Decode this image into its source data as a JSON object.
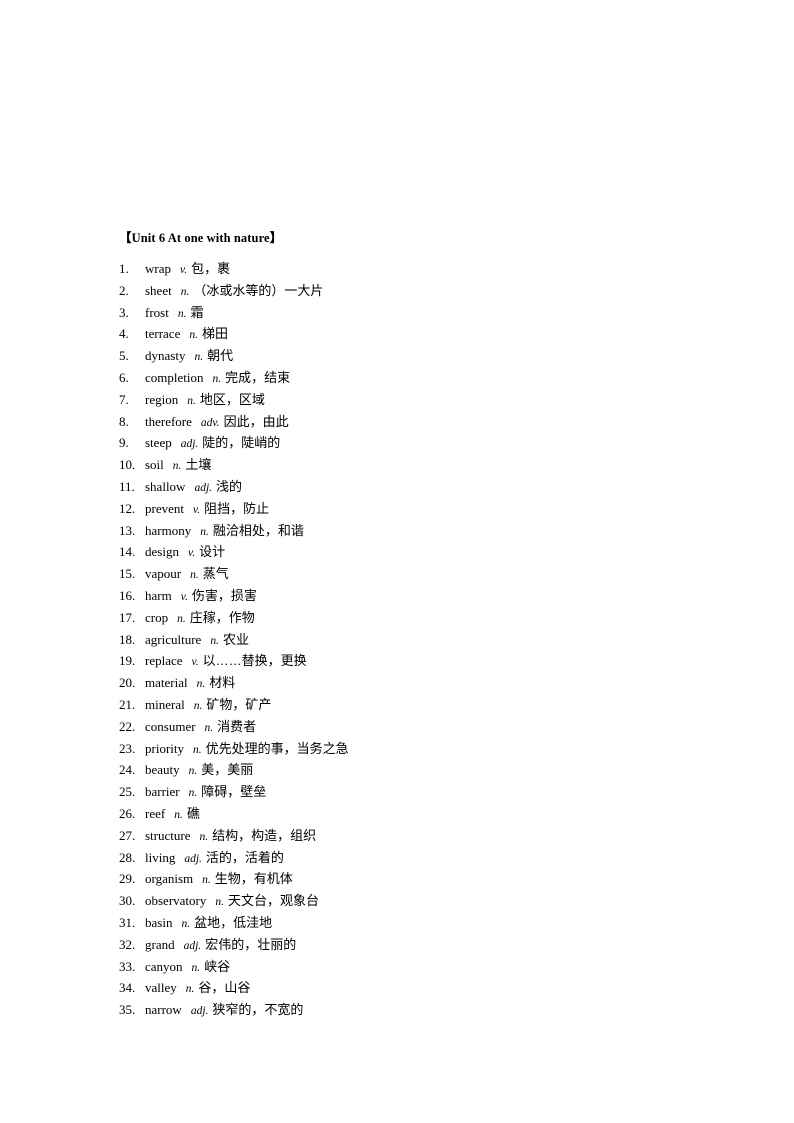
{
  "document": {
    "title": "【Unit 6 At one with nature】",
    "background_color": "#ffffff",
    "text_color": "#000000"
  },
  "vocabulary": [
    {
      "num": "1.",
      "word": "wrap",
      "pos": "v.",
      "definition": "包，裹"
    },
    {
      "num": "2.",
      "word": "sheet",
      "pos": "n.",
      "definition": "（冰或水等的）一大片"
    },
    {
      "num": "3.",
      "word": "frost",
      "pos": "n.",
      "definition": "霜"
    },
    {
      "num": "4.",
      "word": "terrace",
      "pos": "n.",
      "definition": "梯田"
    },
    {
      "num": "5.",
      "word": "dynasty",
      "pos": "n.",
      "definition": "朝代"
    },
    {
      "num": "6.",
      "word": "completion",
      "pos": "n.",
      "definition": "完成，结束"
    },
    {
      "num": "7.",
      "word": "region",
      "pos": "n.",
      "definition": "地区，区域"
    },
    {
      "num": "8.",
      "word": "therefore",
      "pos": "adv.",
      "definition": "因此，由此"
    },
    {
      "num": "9.",
      "word": "steep",
      "pos": "adj.",
      "definition": "陡的，陡峭的"
    },
    {
      "num": "10.",
      "word": "soil",
      "pos": "n.",
      "definition": "土壤"
    },
    {
      "num": "11.",
      "word": "shallow",
      "pos": "adj.",
      "definition": "浅的"
    },
    {
      "num": "12.",
      "word": "prevent",
      "pos": "v.",
      "definition": "阻挡，防止"
    },
    {
      "num": "13.",
      "word": "harmony",
      "pos": "n.",
      "definition": "融洽相处，和谐"
    },
    {
      "num": "14.",
      "word": "design",
      "pos": "v.",
      "definition": "设计"
    },
    {
      "num": "15.",
      "word": "vapour",
      "pos": "n.",
      "definition": "蒸气"
    },
    {
      "num": "16.",
      "word": "harm",
      "pos": "v.",
      "definition": "伤害，损害"
    },
    {
      "num": "17.",
      "word": "crop",
      "pos": "n.",
      "definition": "庄稼，作物"
    },
    {
      "num": "18.",
      "word": "agriculture",
      "pos": "n.",
      "definition": "农业"
    },
    {
      "num": "19.",
      "word": "replace",
      "pos": "v.",
      "definition": "以……替换，更换"
    },
    {
      "num": "20.",
      "word": "material",
      "pos": "n.",
      "definition": "材料"
    },
    {
      "num": "21.",
      "word": "mineral",
      "pos": "n.",
      "definition": "矿物，矿产"
    },
    {
      "num": "22.",
      "word": "consumer",
      "pos": "n.",
      "definition": "消费者"
    },
    {
      "num": "23.",
      "word": "priority",
      "pos": "n.",
      "definition": "优先处理的事，当务之急"
    },
    {
      "num": "24.",
      "word": "beauty",
      "pos": "n.",
      "definition": "美，美丽"
    },
    {
      "num": "25.",
      "word": "barrier",
      "pos": "n.",
      "definition": "障碍，壁垒"
    },
    {
      "num": "26.",
      "word": "reef",
      "pos": "n.",
      "definition": "礁"
    },
    {
      "num": "27.",
      "word": "structure",
      "pos": "n.",
      "definition": "结构，构造，组织"
    },
    {
      "num": "28.",
      "word": "living",
      "pos": "adj.",
      "definition": "活的，活着的"
    },
    {
      "num": "29.",
      "word": "organism",
      "pos": "n.",
      "definition": "生物，有机体"
    },
    {
      "num": "30.",
      "word": "observatory",
      "pos": "n.",
      "definition": "天文台，观象台"
    },
    {
      "num": "31.",
      "word": "basin",
      "pos": "n.",
      "definition": "盆地，低洼地"
    },
    {
      "num": "32.",
      "word": "grand",
      "pos": "adj.",
      "definition": "宏伟的，壮丽的"
    },
    {
      "num": "33.",
      "word": "canyon",
      "pos": "n.",
      "definition": "峡谷"
    },
    {
      "num": "34.",
      "word": "valley",
      "pos": "n.",
      "definition": "谷，山谷"
    },
    {
      "num": "35.",
      "word": "narrow",
      "pos": "adj.",
      "definition": "狭窄的，不宽的"
    }
  ]
}
